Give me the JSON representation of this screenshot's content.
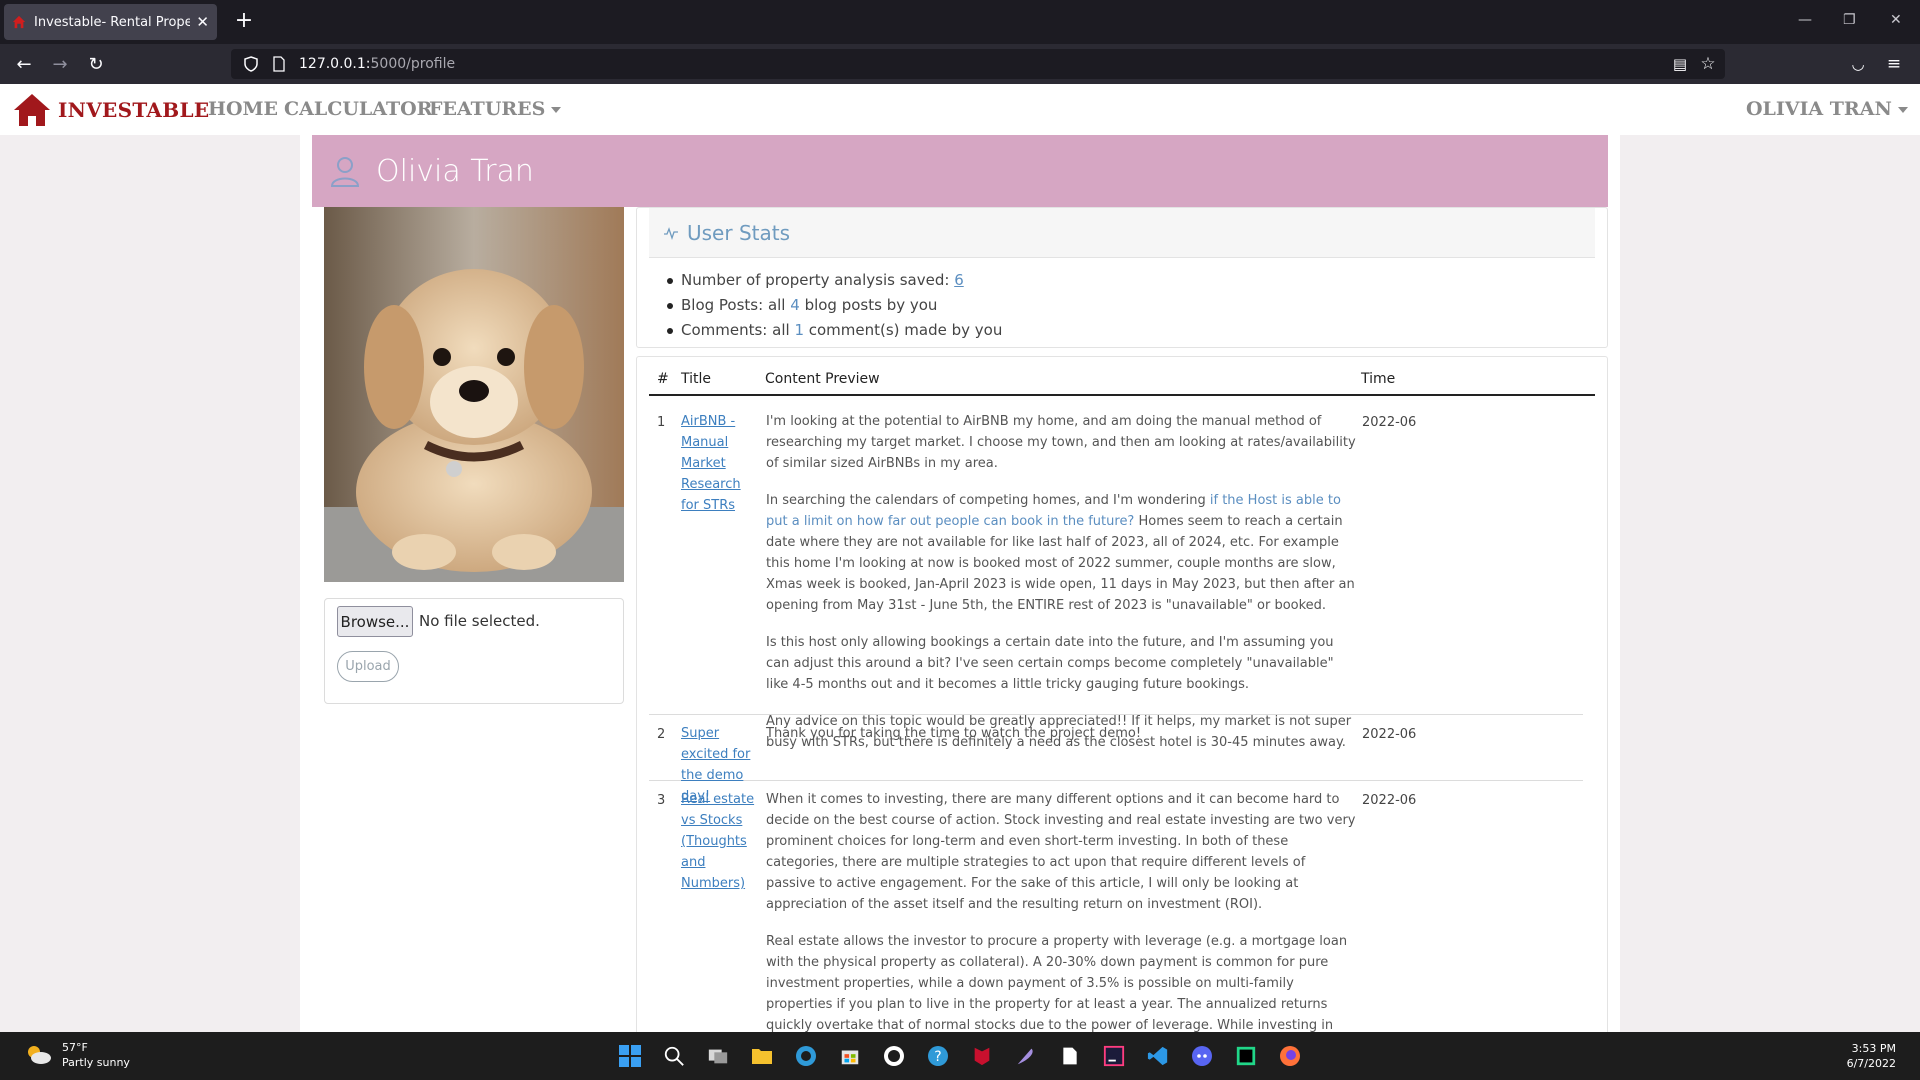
{
  "browser": {
    "tab_title": "Investable- Rental Property Ana",
    "url_host": "127.0.0.1:",
    "url_path": "5000/profile"
  },
  "site": {
    "brand": "INVESTABLE",
    "nav": {
      "home": "HOME",
      "calculator": "CALCULATOR",
      "features": "FEATURES",
      "user": "OLIVIA TRAN"
    }
  },
  "profile": {
    "name": "Olivia Tran",
    "upload": {
      "browse_label": "Browse...",
      "file_status": "No file selected.",
      "upload_label": "Upload"
    }
  },
  "stats": {
    "title": "User Stats",
    "analysis_prefix": "Number of property analysis saved: ",
    "analysis_count": "6",
    "blog_prefix": "Blog Posts: all ",
    "blog_count": "4",
    "blog_suffix": " blog posts by you",
    "comments_prefix": "Comments: all ",
    "comments_count": "1",
    "comments_suffix": " comment(s) made by you"
  },
  "table": {
    "headers": {
      "num": "#",
      "title": "Title",
      "content": "Content Preview",
      "time": "Time"
    },
    "rows": [
      {
        "num": "1",
        "title": "AirBNB - Manual Market Research for STRs",
        "p1": "I'm looking at the potential to AirBNB my home, and am doing the manual method of researching my target market. I choose my town, and then am looking at rates/availability of similar sized AirBNBs in my area.",
        "p2_a": "In searching the calendars of competing homes, and I'm wondering ",
        "p2_link": "if the Host is able to put a limit on how far out people can book in the future?",
        "p2_b": " Homes seem to reach a certain date where they are not available for like last half of 2023, all of 2024, etc. For example this home I'm looking at now is booked most of 2022 summer, couple months are slow, Xmas week is booked, Jan-April 2023 is wide open, 11 days in May 2023, but then after an opening from May 31st - June 5th, the ENTIRE rest of 2023 is \"unavailable\" or booked.",
        "p3": "Is this host only allowing bookings a certain date into the future, and I'm assuming you can adjust this around a bit? I've seen certain comps become completely \"unavailable\" like 4-5 months out and it becomes a little tricky gauging future bookings.",
        "p4": "Any advice on this topic would be greatly appreciated!! If it helps, my market is not super busy with STRs, but there is definitely a need as the closest hotel is 30-45 minutes away.",
        "time": "2022-06"
      },
      {
        "num": "2",
        "title": "Super excited for the demo day!",
        "p1": "Thank you for taking the time to watch the project demo!",
        "time": "2022-06"
      },
      {
        "num": "3",
        "title": "Real estate vs Stocks (Thoughts and Numbers)",
        "p1": "When it comes to investing, there are many different options and it can become hard to decide on the best course of action. Stock investing and real estate investing are two very prominent choices for long-term and even short-term investing. In both of these categories, there are multiple strategies to act upon that require different levels of passive to active engagement. For the sake of this article, I will only be looking at appreciation of the asset itself and the resulting return on investment (ROI).",
        "p2": "Real estate allows the investor to procure a property with leverage (e.g. a mortgage loan with the physical property as collateral). A 20-30% down payment is common for pure investment properties, while a down payment of 3.5% is possible on multi-family properties if you plan to live in the property for at least a year. The annualized returns quickly overtake that of normal stocks due to the power of leverage. While investing in real estate in this manner is usually not as easy as buying an index fund of stocks and forgetting it, the purpose of this article is to visually show the",
        "time": "2022-06"
      }
    ]
  },
  "taskbar": {
    "temp": "57°F",
    "condition": "Partly sunny",
    "time": "3:53 PM",
    "date": "6/7/2022"
  },
  "colors": {
    "brand": "#a1181c",
    "profile_header": "#d6a6c3",
    "link": "#3d7fbf"
  }
}
